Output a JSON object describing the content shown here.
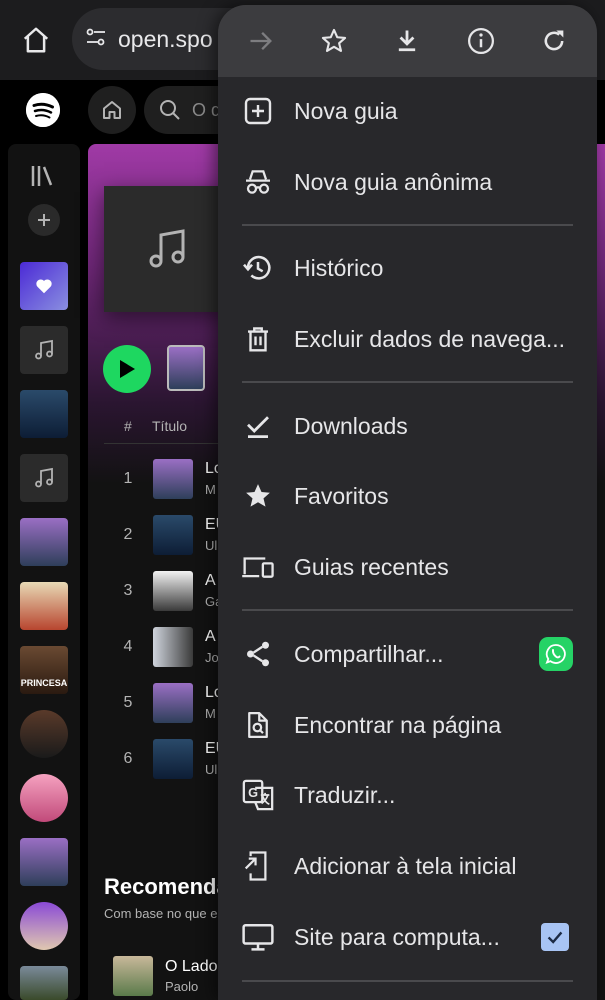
{
  "browser": {
    "url": "open.spo"
  },
  "spotify": {
    "search_placeholder": "O q",
    "track_header": {
      "num": "#",
      "title": "Título"
    },
    "tracks": [
      {
        "num": "1",
        "title": "Lo",
        "artist": "M"
      },
      {
        "num": "2",
        "title": "EU",
        "artist": "Ul"
      },
      {
        "num": "3",
        "title": "A",
        "artist": "Ga"
      },
      {
        "num": "4",
        "title": "A",
        "artist": "Jo"
      },
      {
        "num": "5",
        "title": "Lo",
        "artist": "M"
      },
      {
        "num": "6",
        "title": "EU",
        "artist": "Ul"
      }
    ],
    "sidebar_thumb_text": "PRINCESA",
    "recommended": {
      "title": "Recomendados",
      "subtitle": "Com base no que e",
      "item_title": "O Lado",
      "item_artist": "Paolo"
    }
  },
  "menu": {
    "items": [
      {
        "label": "Nova guia",
        "icon": "new-tab-icon"
      },
      {
        "label": "Nova guia anônima",
        "icon": "incognito-icon"
      },
      {
        "label": "Histórico",
        "icon": "history-icon"
      },
      {
        "label": "Excluir dados de navega...",
        "icon": "trash-icon"
      },
      {
        "label": "Downloads",
        "icon": "downloads-icon"
      },
      {
        "label": "Favoritos",
        "icon": "star-icon"
      },
      {
        "label": "Guias recentes",
        "icon": "devices-icon"
      },
      {
        "label": "Compartilhar...",
        "icon": "share-icon"
      },
      {
        "label": "Encontrar na página",
        "icon": "find-icon"
      },
      {
        "label": "Traduzir...",
        "icon": "translate-icon"
      },
      {
        "label": "Adicionar à tela inicial",
        "icon": "add-home-icon"
      },
      {
        "label": "Site para computa...",
        "icon": "desktop-icon",
        "checked": true
      }
    ]
  },
  "colors": {
    "spotify_green": "#1ed760",
    "menu_bg": "#28282b",
    "whatsapp_green": "#25d366",
    "checkbox_blue": "#a8c4f4"
  }
}
